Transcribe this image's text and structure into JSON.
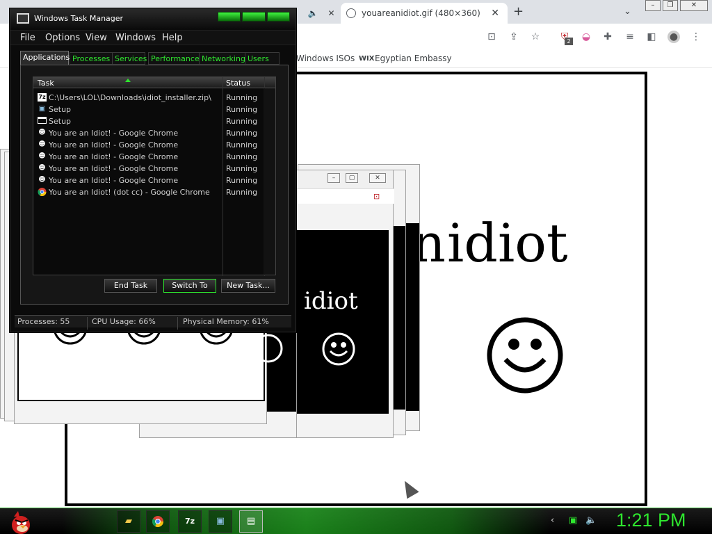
{
  "browser": {
    "tabs": [
      {
        "label": "youareanidiot.gif (480×360)",
        "active": true
      }
    ],
    "bookmarks": [
      "Windows ISOs",
      "Egyptian Embassy"
    ],
    "extension_badge": "2"
  },
  "gif": {
    "text_main": "idiot",
    "text_partial": "n",
    "popup_text": "idiot"
  },
  "task_manager": {
    "title": "Windows Task Manager",
    "menu": [
      "File",
      "Options",
      "View",
      "Windows",
      "Help"
    ],
    "tabs": [
      "Applications",
      "Processes",
      "Services",
      "Performance",
      "Networking",
      "Users"
    ],
    "columns": [
      "Task",
      "Status"
    ],
    "rows": [
      {
        "task": "C:\\Users\\LOL\\Downloads\\idiot_installer.zip\\",
        "status": "Running",
        "icon": "7z-icon"
      },
      {
        "task": "Setup",
        "status": "Running",
        "icon": "setup-icon"
      },
      {
        "task": "Setup",
        "status": "Running",
        "icon": "window-icon"
      },
      {
        "task": "You are an Idiot! - Google Chrome",
        "status": "Running",
        "icon": "smiley-icon"
      },
      {
        "task": "You are an Idiot! - Google Chrome",
        "status": "Running",
        "icon": "smiley-icon"
      },
      {
        "task": "You are an Idiot! - Google Chrome",
        "status": "Running",
        "icon": "smiley-icon"
      },
      {
        "task": "You are an Idiot! - Google Chrome",
        "status": "Running",
        "icon": "smiley-icon"
      },
      {
        "task": "You are an Idiot! - Google Chrome",
        "status": "Running",
        "icon": "smiley-icon"
      },
      {
        "task": "You are an Idiot! (dot cc) - Google Chrome",
        "status": "Running",
        "icon": "chrome-icon"
      }
    ],
    "buttons": {
      "end_task": "End Task",
      "switch_to": "Switch To",
      "new_task": "New Task..."
    },
    "statusbar": {
      "processes": "Processes: 55",
      "cpu": "CPU Usage: 66%",
      "memory": "Physical Memory: 61%"
    }
  },
  "taskbar": {
    "clock": "1:21 PM",
    "apps": [
      "file-explorer-icon",
      "chrome-icon",
      "7z-icon",
      "setup-icon",
      "task-manager-icon"
    ]
  },
  "colors": {
    "accent": "#2ee62e",
    "bg": "#0b0b0b"
  }
}
